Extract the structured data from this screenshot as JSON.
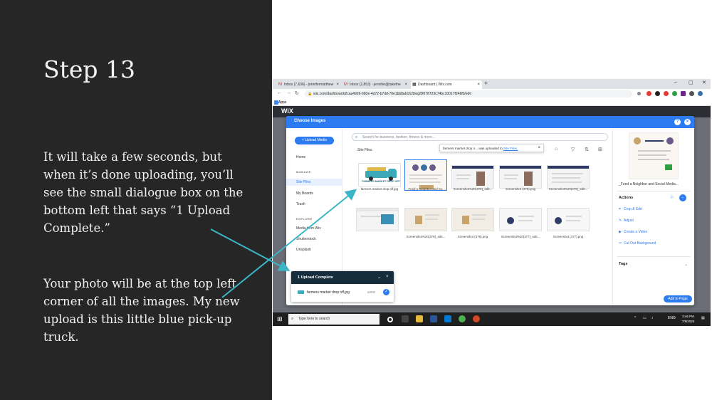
{
  "slide": {
    "title": "Step 13",
    "paragraph1": "It will take a few seconds, but when it’s done uploading, you’ll see the small dialogue box on the bottom left that says “1 Upload Complete.”",
    "paragraph2": "Your photo will be at the top left corner of all the images. My new upload is this little blue pick-up truck."
  },
  "browser": {
    "tabs": [
      "Inbox (7,636) - jennifermatthew",
      "Inbox (2,853) - jennifer@takethe",
      "Dashboard | Wix.com"
    ],
    "new_tab": "+",
    "url": "wix.com/dashboard/2caa4926-683e-4d72-b7dd-70e1bb8ab1fc/blog/5f078723c74bc10017f246f0/edit",
    "bookmarks_apps": "Apps"
  },
  "wix": {
    "logo": "WiX"
  },
  "modal": {
    "title": "Choose Images",
    "upload_button": "+ Upload Media",
    "sidebar": {
      "home": "Home",
      "manage_header": "MANAGE",
      "site_files": "Site Files",
      "my_boards": "My Boards",
      "trash": "Trash",
      "explore_header": "EXPLORE",
      "media_from_wix": "Media from Wix",
      "shutterstock": "Shutterstock",
      "unsplash": "Unsplash"
    },
    "search_placeholder": "Search for business, fashion, fitness & more...",
    "breadcrumb": "Site Files",
    "toast": {
      "text": "farmers market drop o... was uploaded to ",
      "link": "Site Files.",
      "close": "×"
    },
    "thumbs": [
      {
        "caption": "farmers market drop off.jpg"
      },
      {
        "caption": "_Feed a Neighbor and So..."
      },
      {
        "caption": "Screenshot%20(378)_edit..."
      },
      {
        "caption": "Screenshot (376).png"
      },
      {
        "caption": "Screenshot%20(379)_edit..."
      },
      {
        "caption": ""
      },
      {
        "caption": "Screenshot%20(378)_edit..."
      },
      {
        "caption": "Screenshot (378).png"
      },
      {
        "caption": "Screenshot%20(377)_edit..."
      },
      {
        "caption": "Screenshot (377).png"
      }
    ],
    "truck_label": "FARMERS MARKET DROP OFF",
    "right_panel": {
      "file_name": "_Feed a Neighbor and Social Media...",
      "actions_header": "Actions",
      "more": "…",
      "actions": [
        "Crop & Edit",
        "Adjust",
        "Create a Video",
        "Cut Out Background"
      ],
      "tags_header": "Tags",
      "add_to_page": "Add to Page"
    }
  },
  "upload_box": {
    "title": "1 Upload Complete",
    "file": "farmers market drop off.jpg",
    "size": "60KB"
  },
  "taskbar": {
    "search": "Type here to search",
    "lang": "ENG",
    "time": "2:46 PM",
    "date": "7/9/2020"
  },
  "colors": {
    "slide_bg": "#262626",
    "wix_blue": "#2d7bf0",
    "arrow": "#3bb6c6",
    "upload_header": "#162d3d"
  }
}
